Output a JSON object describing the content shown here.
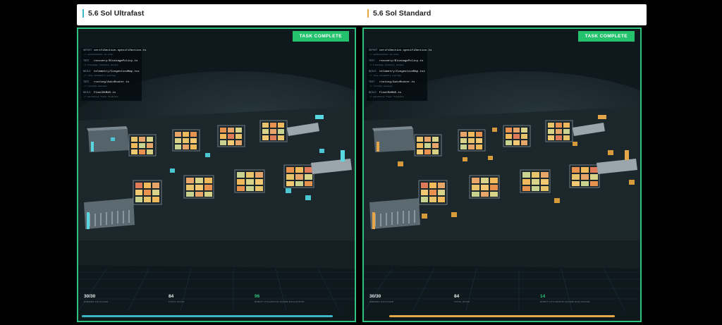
{
  "header": {
    "left_title": "5.6 Sol Ultrafast",
    "right_title": "5.6 Sol Standard"
  },
  "colors": {
    "ultrafast_accent": "#3fb6c7",
    "standard_accent": "#e5a649",
    "complete_border": "#2ec27e",
    "badge": "#25c26e"
  },
  "panels": [
    {
      "badge": "TASK COMPLETE",
      "log": [
        {
          "tag": "REPORT",
          "file": "verifiSection.specifiSection.ts",
          "sub": "// optimization as plan"
        },
        {
          "tag": "TEST",
          "file": "recovery/BlockagePolicy.ts",
          "sub": "// blockage recovery policy"
        },
        {
          "tag": "BUILD",
          "file": "telemetry/CongestionMap.tsx",
          "sub": "// live telemetry overlay"
        },
        {
          "tag": "TEST",
          "file": "routing/AutoRouter.ts",
          "sub": "// reroute mission"
        },
        {
          "tag": "BUILD",
          "file": "FinalReMAS.ts",
          "sub": "// warehouse floor finalize"
        }
      ],
      "stats": [
        {
          "value": "30/30",
          "label": "ORDERS FULFILLED"
        },
        {
          "value": "84",
          "label": "TOTAL PICKS"
        },
        {
          "value": "96",
          "label": "ROBOT UTILIZATION SCORE EVALUATION"
        }
      ],
      "progress": 1.0
    },
    {
      "badge": "TASK COMPLETE",
      "log": [
        {
          "tag": "REPORT",
          "file": "verifiSection.specifiSection.ts",
          "sub": "// optimization as plan"
        },
        {
          "tag": "TEST",
          "file": "recovery/BlockagePolicy.ts",
          "sub": "// blockage recovery policy"
        },
        {
          "tag": "BUILD",
          "file": "telemetry/CongestionMap.tsx",
          "sub": "// live telemetry overlay"
        },
        {
          "tag": "TEST",
          "file": "routing/AutoRouter.ts",
          "sub": "// reroute mission"
        },
        {
          "tag": "BUILD",
          "file": "FinalReMAS.ts",
          "sub": "// warehouse floor finalize"
        }
      ],
      "stats": [
        {
          "value": "30/30",
          "label": "ORDERS FULFILLED"
        },
        {
          "value": "84",
          "label": "TOTAL PICKS"
        },
        {
          "value": "14",
          "label": "ROBOT UTILIZATION SCORE EVALUATION"
        }
      ],
      "progress": 1.0
    }
  ]
}
